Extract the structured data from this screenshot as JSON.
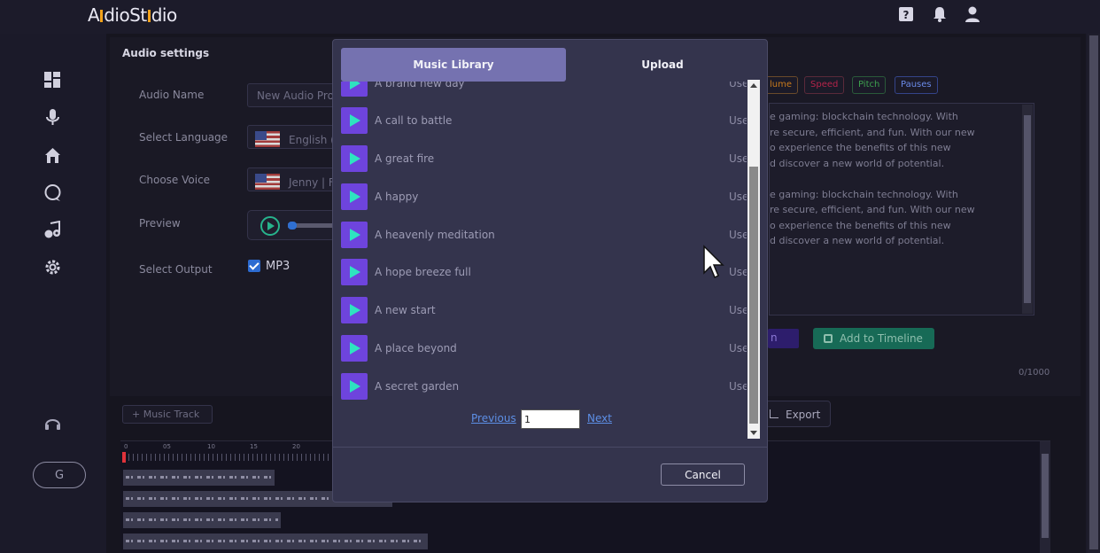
{
  "app": {
    "logo_text": "AudioStudio"
  },
  "settings": {
    "title": "Audio settings",
    "labels": {
      "audio_name": "Audio Name",
      "language": "Select Language",
      "voice": "Choose Voice",
      "preview": "Preview",
      "output": "Select Output"
    },
    "audio_name_value": "New Audio Pro",
    "language_value": "English (",
    "voice_value": "Jenny | F",
    "output_value": "MP3"
  },
  "chips": [
    "lume",
    "Speed",
    "Pitch",
    "Pauses"
  ],
  "script_text": [
    "e gaming: blockchain technology. With",
    "re secure, efficient, and fun. With our new",
    "o experience the benefits of this new",
    "d discover a new world of potential.",
    "e gaming: blockchain technology. With",
    "re secure, efficient, and fun. With our new",
    "o experience the benefits of this new",
    "d discover a new world of potential."
  ],
  "buttons": {
    "purple_partial": "n",
    "add_to_timeline": "Add to Timeline",
    "export": "Export",
    "music_track": "+ Music Track",
    "sidebar_g": "G"
  },
  "counter": "0/1000",
  "timeline_ruler": [
    "0",
    "05",
    "10",
    "15",
    "20"
  ],
  "modal": {
    "tabs": {
      "library": "Music Library",
      "upload": "Upload"
    },
    "tracks": [
      {
        "name": "A brand new day",
        "action": "Use"
      },
      {
        "name": "A call to battle",
        "action": "Use"
      },
      {
        "name": "A great fire",
        "action": "Use"
      },
      {
        "name": "A happy",
        "action": "Use"
      },
      {
        "name": "A heavenly meditation",
        "action": "Use"
      },
      {
        "name": "A hope breeze full",
        "action": "Use"
      },
      {
        "name": "A new start",
        "action": "Use"
      },
      {
        "name": "A place beyond",
        "action": "Use"
      },
      {
        "name": "A secret garden",
        "action": "Use"
      }
    ],
    "pager": {
      "previous": "Previous",
      "page": "1",
      "next": "Next"
    },
    "cancel": "Cancel"
  },
  "colors": {
    "accent_purple": "#6e44dd",
    "play_glyph": "#2ee3c0",
    "tab_active": "#7572b0",
    "link_blue": "#5d8fe6",
    "chip_volume": "#c97a1c",
    "chip_speed": "#b3244a",
    "chip_pitch": "#3da04e",
    "chip_pauses": "#6a8ae8"
  }
}
